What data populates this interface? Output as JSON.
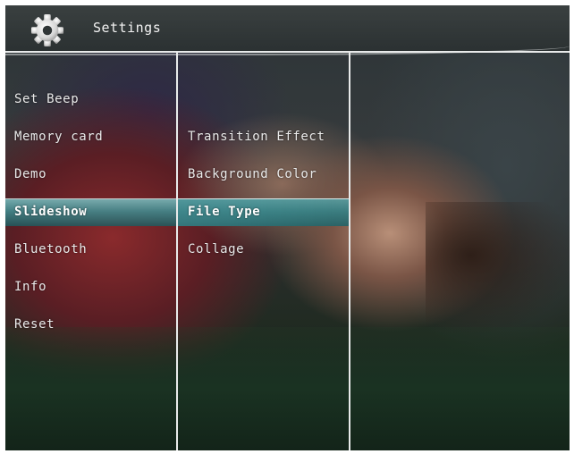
{
  "header": {
    "title": "Settings",
    "icon": "gear-icon"
  },
  "menu_level1": {
    "items": [
      {
        "label": "Set Beep",
        "selected": false
      },
      {
        "label": "Memory card",
        "selected": false
      },
      {
        "label": "Demo",
        "selected": false
      },
      {
        "label": "Slideshow",
        "selected": true
      },
      {
        "label": "Bluetooth",
        "selected": false
      },
      {
        "label": "Info",
        "selected": false
      },
      {
        "label": "Reset",
        "selected": false
      }
    ]
  },
  "menu_level2": {
    "items": [
      {
        "label": "Transition Effect",
        "selected": false
      },
      {
        "label": "Background Color",
        "selected": false
      },
      {
        "label": "File Type",
        "selected": true
      },
      {
        "label": "Collage",
        "selected": false
      }
    ]
  },
  "colors": {
    "highlight": "#3f8f93",
    "text": "#eaeaea",
    "divider": "#e8eaea"
  }
}
